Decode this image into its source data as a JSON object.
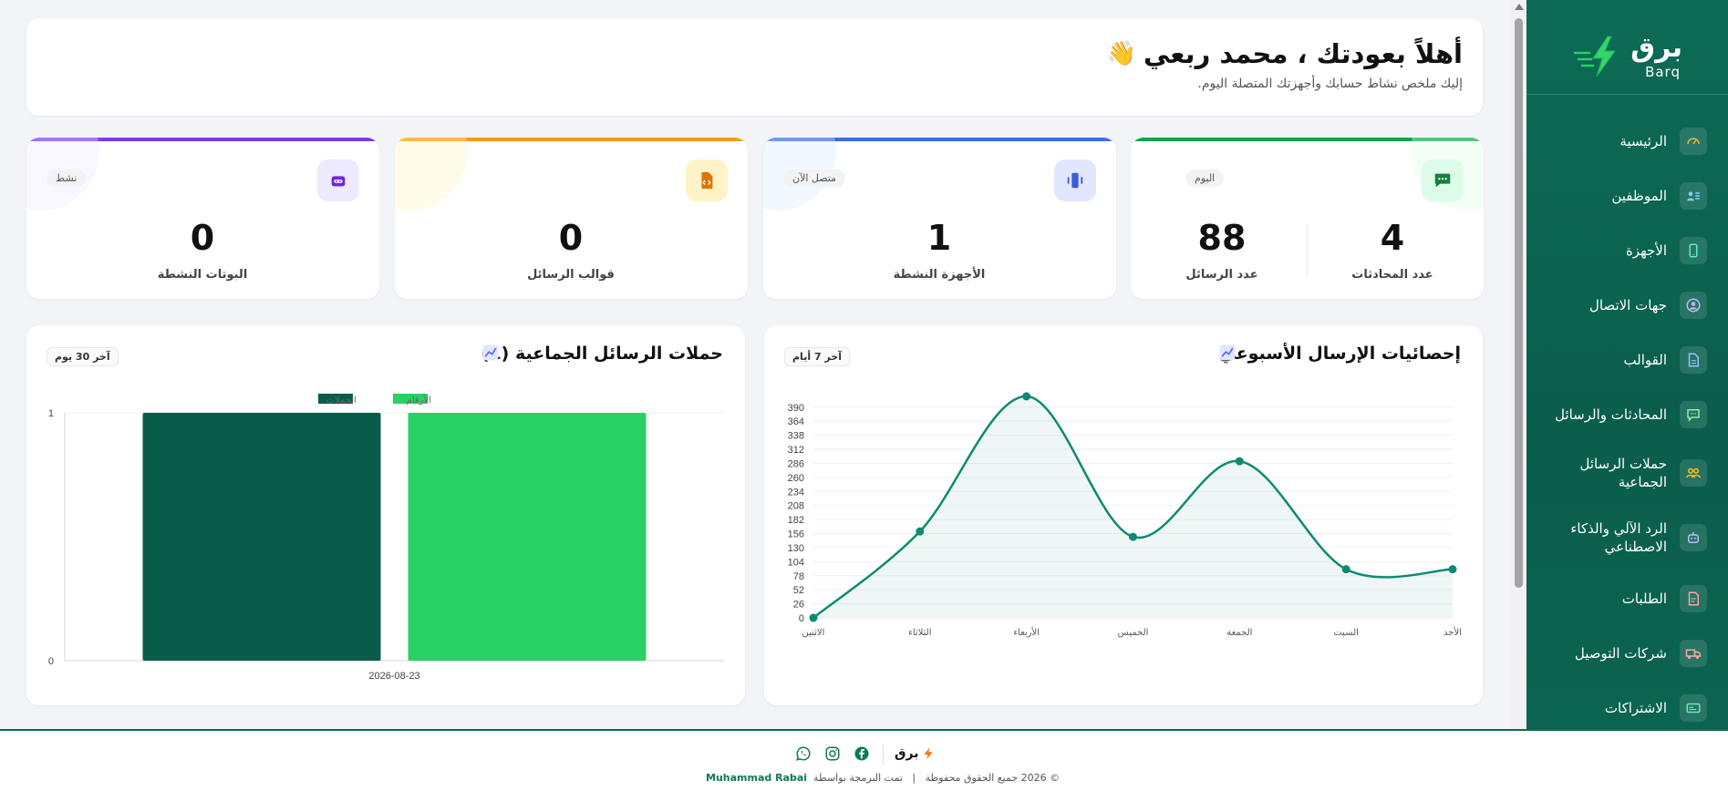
{
  "sidebar": {
    "logo_word": "برق",
    "logo_latin": "Barq",
    "items": [
      {
        "label": "الرئيسية",
        "icon": "gauge-icon"
      },
      {
        "label": "الموظفين",
        "icon": "id-card-icon"
      },
      {
        "label": "الأجهزة",
        "icon": "phone-icon"
      },
      {
        "label": "جهات الاتصال",
        "icon": "contact-icon"
      },
      {
        "label": "القوالب",
        "icon": "document-icon"
      },
      {
        "label": "المحادثات والرسائل",
        "icon": "chat-icon"
      },
      {
        "label": "حملات الرسائل الجماعية",
        "icon": "users-icon"
      },
      {
        "label": "الرد الآلي والذكاء الاصطناعي",
        "icon": "robot-icon"
      },
      {
        "label": "الطلبات",
        "icon": "orders-icon"
      },
      {
        "label": "شركات التوصيل",
        "icon": "truck-icon"
      },
      {
        "label": "الاشتراكات",
        "icon": "card-icon"
      }
    ]
  },
  "welcome": {
    "title": "أهلاً بعودتك ، محمد ربعي",
    "wave": "👋",
    "subtitle": "إليك ملخص نشاط حسابك وأجهزتك المتصلة اليوم."
  },
  "stats": {
    "messages_card": {
      "badge": "اليوم",
      "conversations_value": "4",
      "conversations_label": "عدد المحادثات",
      "messages_value": "88",
      "messages_label": "عدد الرسائل"
    },
    "devices_card": {
      "badge": "متصل الآن",
      "value": "1",
      "label": "الأجهزة النشطة"
    },
    "templates_card": {
      "value": "0",
      "label": "قوالب الرسائل"
    },
    "bots_card": {
      "badge": "نشط",
      "value": "0",
      "label": "البوتات النشطة"
    }
  },
  "weekly_chart": {
    "title": "إحصائيات الإرسال الأسبوعي",
    "range": "آخر 7 أيام"
  },
  "campaign_chart": {
    "title": "حملات الرسائل الجماعية (1)",
    "range": "آخر 30 يوم"
  },
  "chart_data": [
    {
      "type": "area",
      "categories": [
        "الاثنين",
        "الثلاثاء",
        "الأربعاء",
        "الخميس",
        "الجمعة",
        "السبت",
        "الأحد"
      ],
      "values": [
        0,
        160,
        410,
        150,
        290,
        90,
        90
      ],
      "yticks": [
        0,
        26,
        52,
        78,
        104,
        130,
        156,
        182,
        208,
        234,
        260,
        286,
        312,
        338,
        364,
        390
      ],
      "ylim": [
        0,
        420
      ],
      "grid": true,
      "color": "#0f8a72"
    },
    {
      "type": "bar",
      "categories": [
        "2026-08-23"
      ],
      "series": [
        {
          "name": "الحملات",
          "values": [
            1
          ],
          "color": "#0a5c4a"
        },
        {
          "name": "الأرقام",
          "values": [
            1
          ],
          "color": "#27d163"
        }
      ],
      "yticks": [
        0,
        1
      ],
      "ylim": [
        0,
        1
      ],
      "legend": "top"
    }
  ],
  "footer": {
    "brand": "برق",
    "copyright": "© 2026 جميع الحقوق محفوظة",
    "separator": "|",
    "credit": "تمت البرمجة بواسطة",
    "author": "Muhammad Rabai"
  },
  "colors": {
    "brand": "#0d6b55",
    "green": "#27d163",
    "purple": "#7c3aed",
    "orange": "#f59e0b",
    "blue": "#3b82f6"
  }
}
